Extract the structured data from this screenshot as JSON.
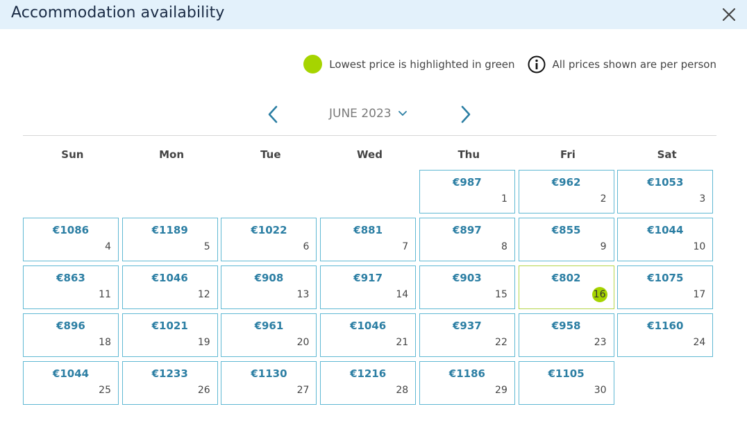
{
  "dialog": {
    "title": "Accommodation availability",
    "close_icon": "close-icon"
  },
  "legend": {
    "lowest_label": "Lowest price is highlighted in green",
    "info_label": "All prices shown are per person",
    "lowest_color": "#a6d400"
  },
  "nav": {
    "month_label": "JUNE 2023"
  },
  "weekdays": [
    "Sun",
    "Mon",
    "Tue",
    "Wed",
    "Thu",
    "Fri",
    "Sat"
  ],
  "accent_color": "#2b7ea3",
  "weeks": [
    [
      null,
      null,
      null,
      null,
      {
        "date": "1",
        "price": "€987"
      },
      {
        "date": "2",
        "price": "€962"
      },
      {
        "date": "3",
        "price": "€1053"
      }
    ],
    [
      {
        "date": "4",
        "price": "€1086"
      },
      {
        "date": "5",
        "price": "€1189"
      },
      {
        "date": "6",
        "price": "€1022"
      },
      {
        "date": "7",
        "price": "€881"
      },
      {
        "date": "8",
        "price": "€897"
      },
      {
        "date": "9",
        "price": "€855"
      },
      {
        "date": "10",
        "price": "€1044"
      }
    ],
    [
      {
        "date": "11",
        "price": "€863"
      },
      {
        "date": "12",
        "price": "€1046"
      },
      {
        "date": "13",
        "price": "€908"
      },
      {
        "date": "14",
        "price": "€917"
      },
      {
        "date": "15",
        "price": "€903"
      },
      {
        "date": "16",
        "price": "€802",
        "lowest": true
      },
      {
        "date": "17",
        "price": "€1075"
      }
    ],
    [
      {
        "date": "18",
        "price": "€896"
      },
      {
        "date": "19",
        "price": "€1021"
      },
      {
        "date": "20",
        "price": "€961"
      },
      {
        "date": "21",
        "price": "€1046"
      },
      {
        "date": "22",
        "price": "€937"
      },
      {
        "date": "23",
        "price": "€958"
      },
      {
        "date": "24",
        "price": "€1160"
      }
    ],
    [
      {
        "date": "25",
        "price": "€1044"
      },
      {
        "date": "26",
        "price": "€1233"
      },
      {
        "date": "27",
        "price": "€1130"
      },
      {
        "date": "28",
        "price": "€1216"
      },
      {
        "date": "29",
        "price": "€1186"
      },
      {
        "date": "30",
        "price": "€1105"
      },
      null
    ]
  ]
}
